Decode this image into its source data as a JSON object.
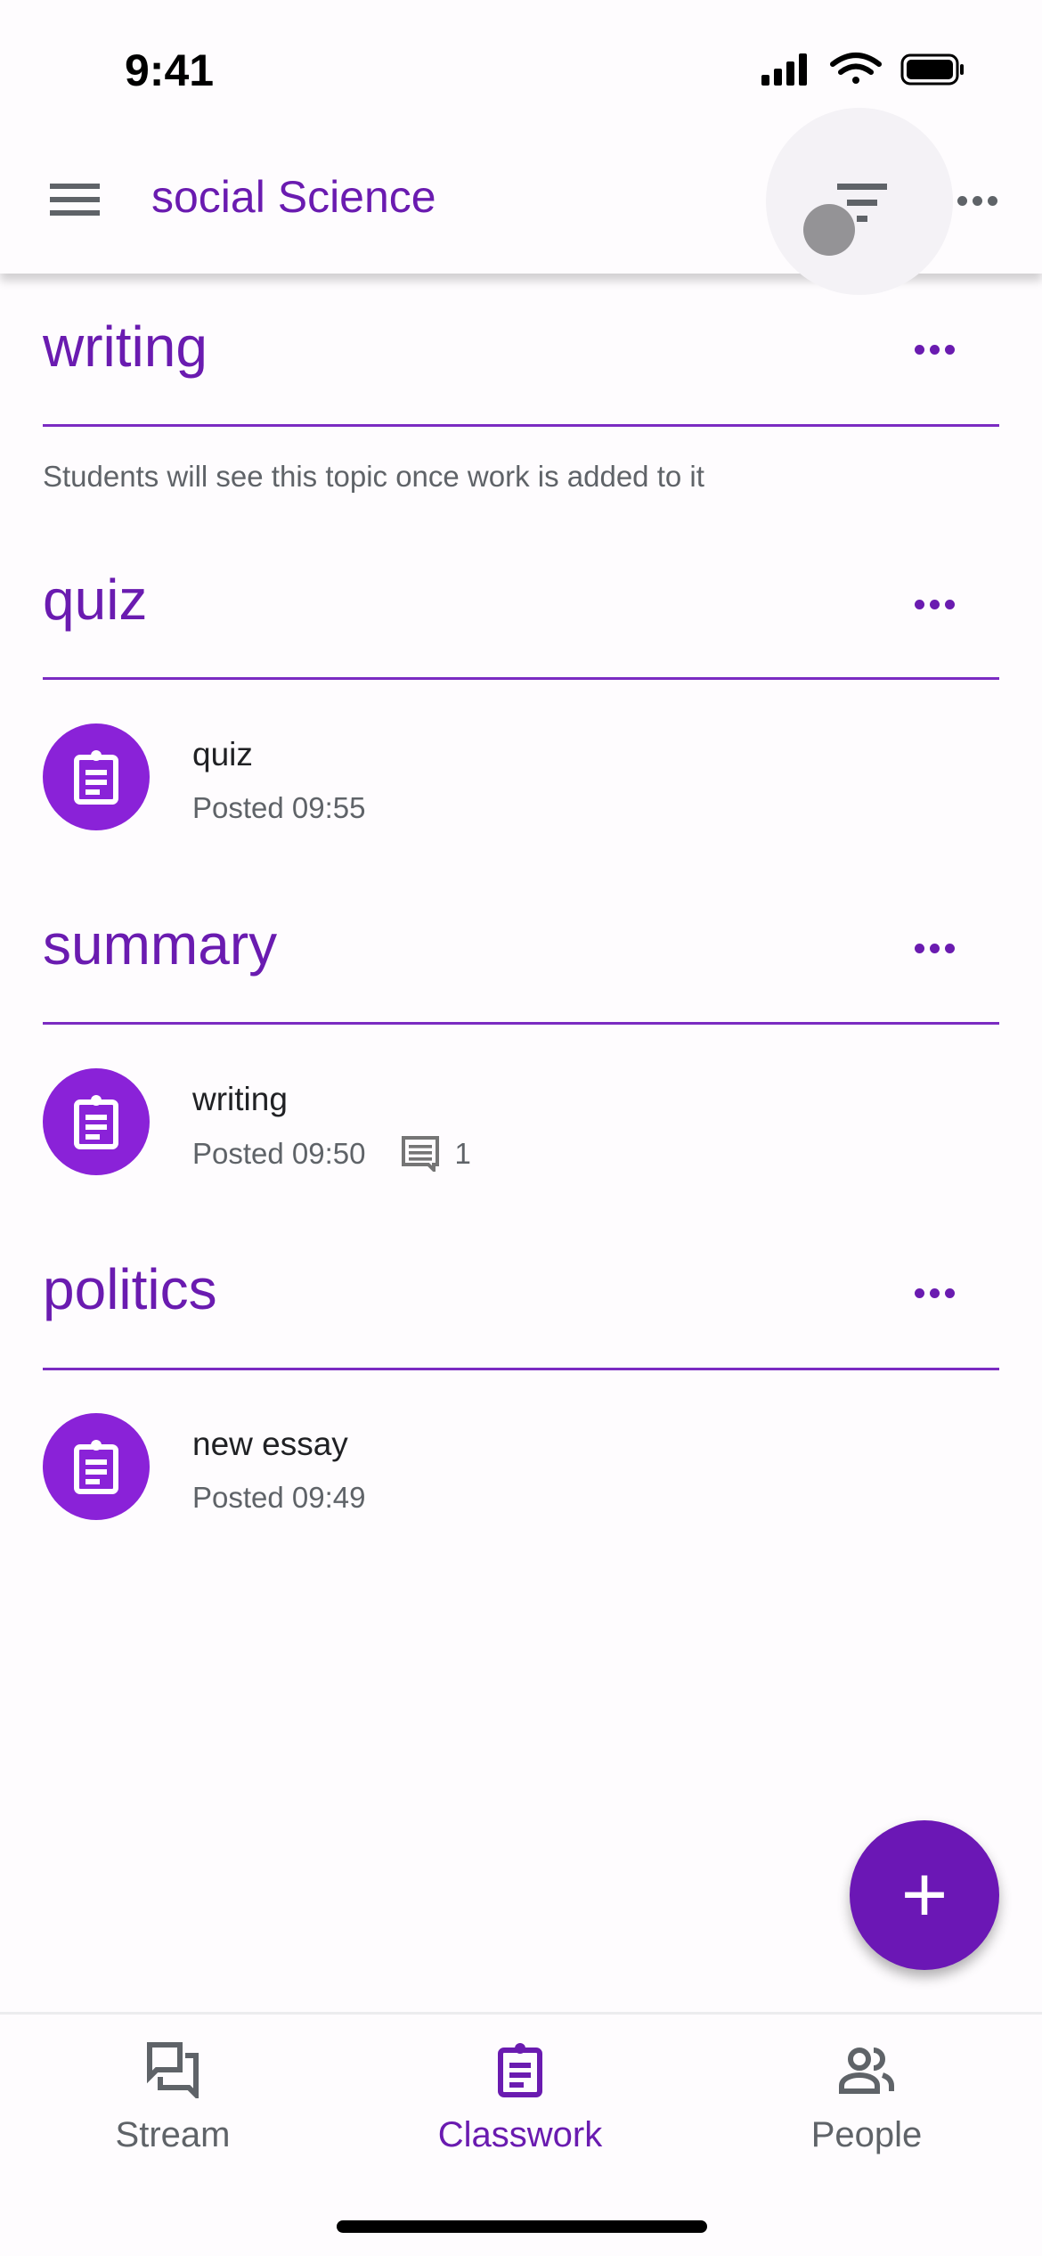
{
  "status_bar": {
    "time": "9:41"
  },
  "app_bar": {
    "title": "social Science",
    "icons": [
      "menu-icon",
      "filter-icon",
      "more-icon"
    ]
  },
  "topics": [
    {
      "title": "writing",
      "note": "Students will see this topic once work is added to it",
      "items": []
    },
    {
      "title": "quiz",
      "items": [
        {
          "title": "quiz",
          "posted": "Posted 09:55"
        }
      ]
    },
    {
      "title": "summary",
      "items": [
        {
          "title": "writing",
          "posted": "Posted 09:50",
          "comments": "1"
        }
      ]
    },
    {
      "title": "politics",
      "items": [
        {
          "title": "new essay",
          "posted": "Posted 09:49"
        }
      ]
    }
  ],
  "fab": {
    "label": "+"
  },
  "bottom_nav": {
    "items": [
      {
        "label": "Stream",
        "active": false
      },
      {
        "label": "Classwork",
        "active": true
      },
      {
        "label": "People",
        "active": false
      }
    ]
  },
  "colors": {
    "accent": "#6a1bb0",
    "item_icon": "#8a22d8",
    "fab": "#6b17b5",
    "muted": "#5f6368"
  }
}
